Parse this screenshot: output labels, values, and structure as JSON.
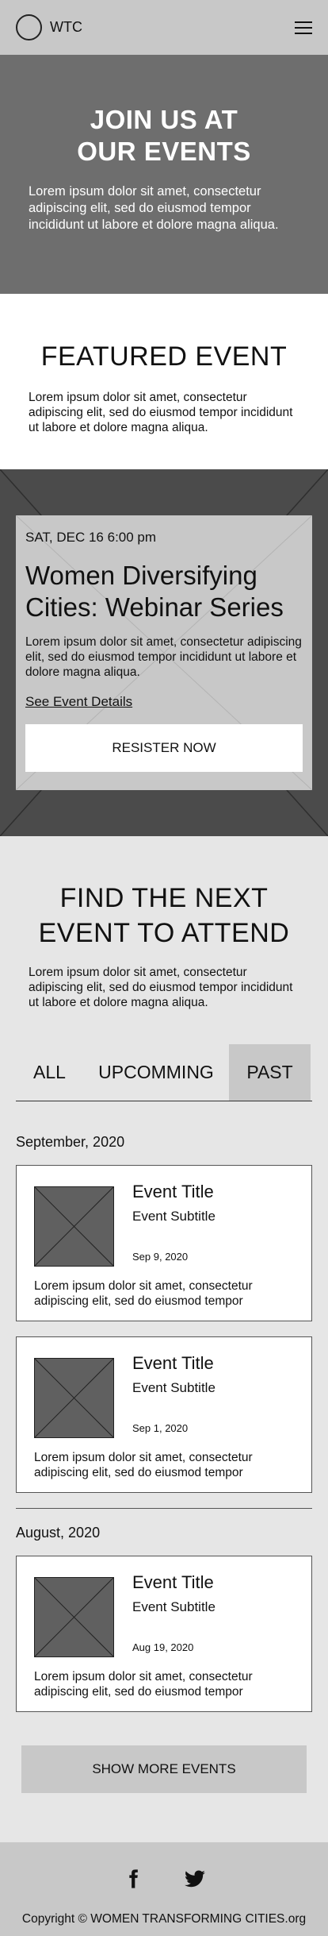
{
  "header": {
    "logo_text": "WTC",
    "logo_icon": "circle-logo-icon",
    "menu_icon": "hamburger-menu-icon"
  },
  "hero": {
    "title_line1": "JOIN US AT",
    "title_line2": "OUR EVENTS",
    "text": "Lorem ipsum dolor sit amet, consectetur adipiscing elit, sed do eiusmod tempor incididunt ut labore et dolore magna aliqua."
  },
  "featured": {
    "heading": "FEATURED EVENT",
    "intro": "Lorem ipsum dolor sit amet, consectetur adipiscing elit, sed do eiusmod tempor incididunt ut labore et dolore magna aliqua.",
    "card": {
      "date": "SAT, DEC 16 6:00 pm",
      "title": "Women Diversifying Cities: Webinar Series",
      "description": "Lorem ipsum dolor sit amet, consectetur adipiscing elit, sed do eiusmod tempor incididunt ut labore et dolore magna aliqua.",
      "details_link": "See Event Details",
      "register_label": "RESISTER NOW"
    }
  },
  "find": {
    "heading_line1": "FIND THE NEXT",
    "heading_line2": "EVENT TO ATTEND",
    "intro": "Lorem ipsum dolor sit amet, consectetur adipiscing elit, sed do eiusmod tempor incididunt ut labore et dolore magna aliqua."
  },
  "tabs": [
    {
      "label": "ALL",
      "active": false
    },
    {
      "label": "UPCOMMING",
      "active": false
    },
    {
      "label": "PAST",
      "active": true
    }
  ],
  "months": [
    {
      "label": "September, 2020",
      "events": [
        {
          "title": "Event Title",
          "subtitle": "Event Subtitle",
          "date": "Sep 9, 2020",
          "description": "Lorem ipsum dolor sit amet, consectetur adipiscing elit, sed do eiusmod tempor"
        },
        {
          "title": "Event Title",
          "subtitle": "Event Subtitle",
          "date": "Sep 1, 2020",
          "description": "Lorem ipsum dolor sit amet, consectetur adipiscing elit, sed do eiusmod tempor"
        }
      ]
    },
    {
      "label": "August, 2020",
      "events": [
        {
          "title": "Event Title",
          "subtitle": "Event Subtitle",
          "date": "Aug 19, 2020",
          "description": "Lorem ipsum dolor sit amet, consectetur adipiscing elit, sed do eiusmod tempor"
        }
      ]
    }
  ],
  "show_more_label": "SHOW MORE EVENTS",
  "footer": {
    "social_icons": [
      "facebook-icon",
      "twitter-icon"
    ],
    "copyright": "Copyright © WOMEN TRANSFORMING CITIES.org"
  },
  "colors": {
    "header_bg": "#c8c8c8",
    "hero_bg": "#6e6e6e",
    "band_bg": "#4b4b4b",
    "card_bg": "#c8c8c8",
    "page_bg": "#e6e6e6",
    "thumb_bg": "#606060"
  }
}
